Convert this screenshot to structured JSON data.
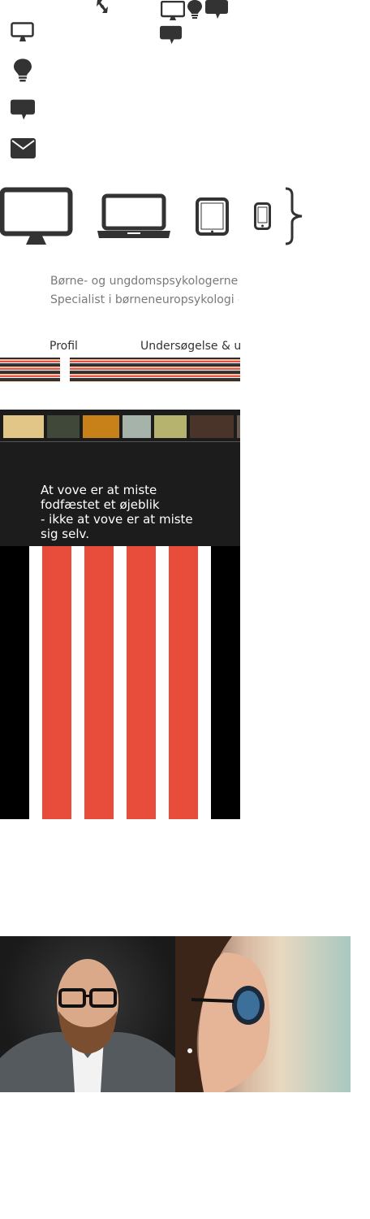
{
  "tagline": {
    "line1": "Børne- og ungdomspsykologerne",
    "line2": "Specialist i børneneuropsykologi og"
  },
  "nav": {
    "items": [
      {
        "label": "Profil"
      },
      {
        "label": "Undersøgelse & udr"
      }
    ]
  },
  "palette": {
    "swatches": [
      "#e2c687",
      "#404839",
      "#c88118",
      "#a5b3ab",
      "#b6b36e",
      "#4a3429",
      "#6a5a4e"
    ]
  },
  "quote": {
    "text": "At vove er at miste\nfodfæstet et øjeblik\n- ikke at vove er at miste\nsig selv."
  },
  "icons": {
    "sprite_top": [
      "expand-arrows-icon",
      "desktop-icon",
      "lightbulb-icon",
      "chat-bubble-icon",
      "chat-bubble-icon"
    ],
    "sprite_column": [
      "desktop-icon",
      "lightbulb-icon",
      "chat-bubble-icon",
      "envelope-icon"
    ],
    "devices": [
      "desktop-monitor-icon",
      "laptop-icon",
      "tablet-icon",
      "smartphone-icon",
      "curly-brace-icon"
    ]
  },
  "colors": {
    "icon": "#333333",
    "dark_panel": "#1c1c1c",
    "red": "#e84c3a"
  },
  "photos": [
    {
      "subject": "bearded-man-with-glasses"
    },
    {
      "subject": "woman-with-sunglasses"
    }
  ]
}
